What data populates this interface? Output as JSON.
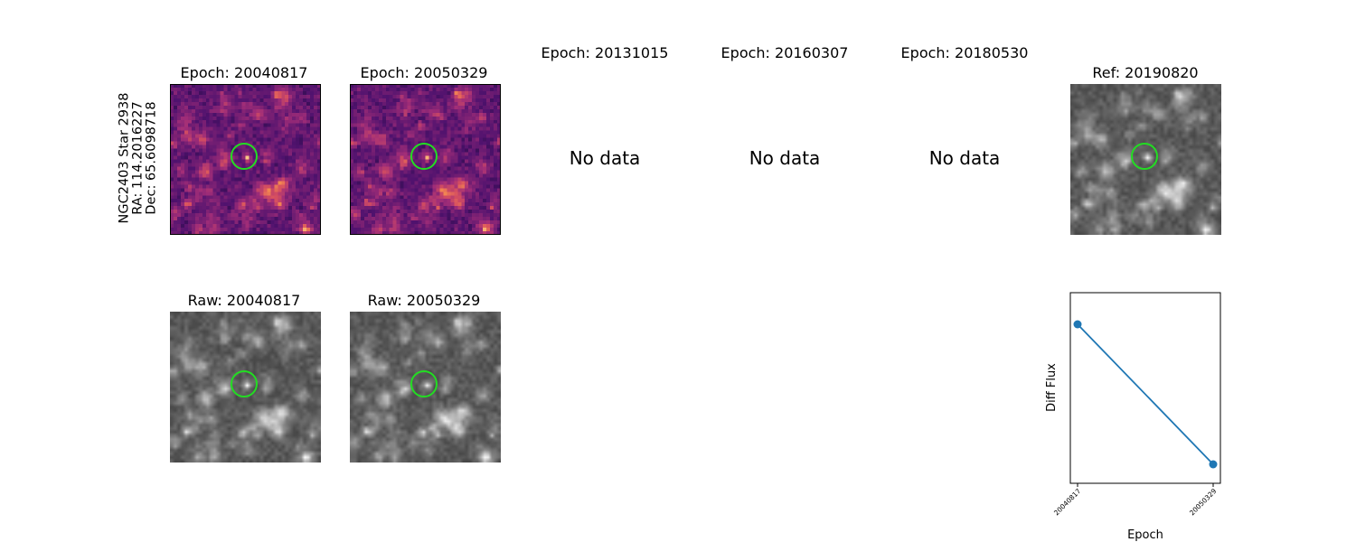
{
  "star": {
    "line1": "NGC2403 Star 2938",
    "line2": "RA: 114.2016227",
    "line3": "Dec: 65.6098718"
  },
  "epochs": [
    {
      "title": "Epoch: 20040817",
      "has_data": true
    },
    {
      "title": "Epoch: 20050329",
      "has_data": true
    },
    {
      "title": "Epoch: 20131015",
      "has_data": false,
      "no_data_text": "No data"
    },
    {
      "title": "Epoch: 20160307",
      "has_data": false,
      "no_data_text": "No data"
    },
    {
      "title": "Epoch: 20180530",
      "has_data": false,
      "no_data_text": "No data"
    }
  ],
  "reference": {
    "title": "Ref: 20190820"
  },
  "raw": [
    {
      "title": "Raw: 20040817"
    },
    {
      "title": "Raw: 20050329"
    }
  ],
  "colors": {
    "ring": "#22dd22",
    "series": "#1f77b4"
  },
  "chart_data": {
    "type": "line",
    "x": [
      "20040817",
      "20050329"
    ],
    "series": [
      {
        "values": [
          1.0,
          0.0
        ]
      }
    ],
    "xlabel": "Epoch",
    "ylabel": "Diff Flux",
    "yticks_shown": false
  }
}
